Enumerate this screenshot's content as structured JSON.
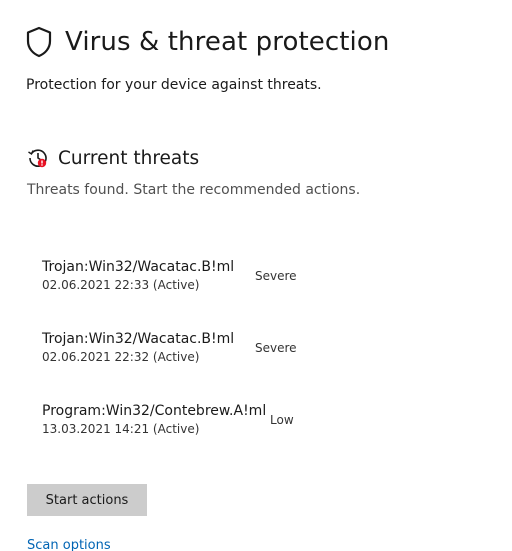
{
  "header": {
    "title": "Virus & threat protection",
    "subtitle": "Protection for your device against threats."
  },
  "current_threats": {
    "title": "Current threats",
    "description": "Threats found. Start the recommended actions.",
    "items": [
      {
        "name": "Trojan:Win32/Wacatac.B!ml",
        "meta": "02.06.2021 22:33 (Active)",
        "severity": "Severe"
      },
      {
        "name": "Trojan:Win32/Wacatac.B!ml",
        "meta": "02.06.2021 22:32 (Active)",
        "severity": "Severe"
      },
      {
        "name": "Program:Win32/Contebrew.A!ml",
        "meta": "13.03.2021 14:21 (Active)",
        "severity": "Low"
      }
    ]
  },
  "actions": {
    "start_label": "Start actions",
    "scan_options_label": "Scan options"
  },
  "icons": {
    "title_icon": "shield-icon",
    "section_icon": "threat-history-icon"
  },
  "colors": {
    "link": "#0064b4",
    "button_bg": "#cccccc",
    "alert_red": "#e81123"
  }
}
